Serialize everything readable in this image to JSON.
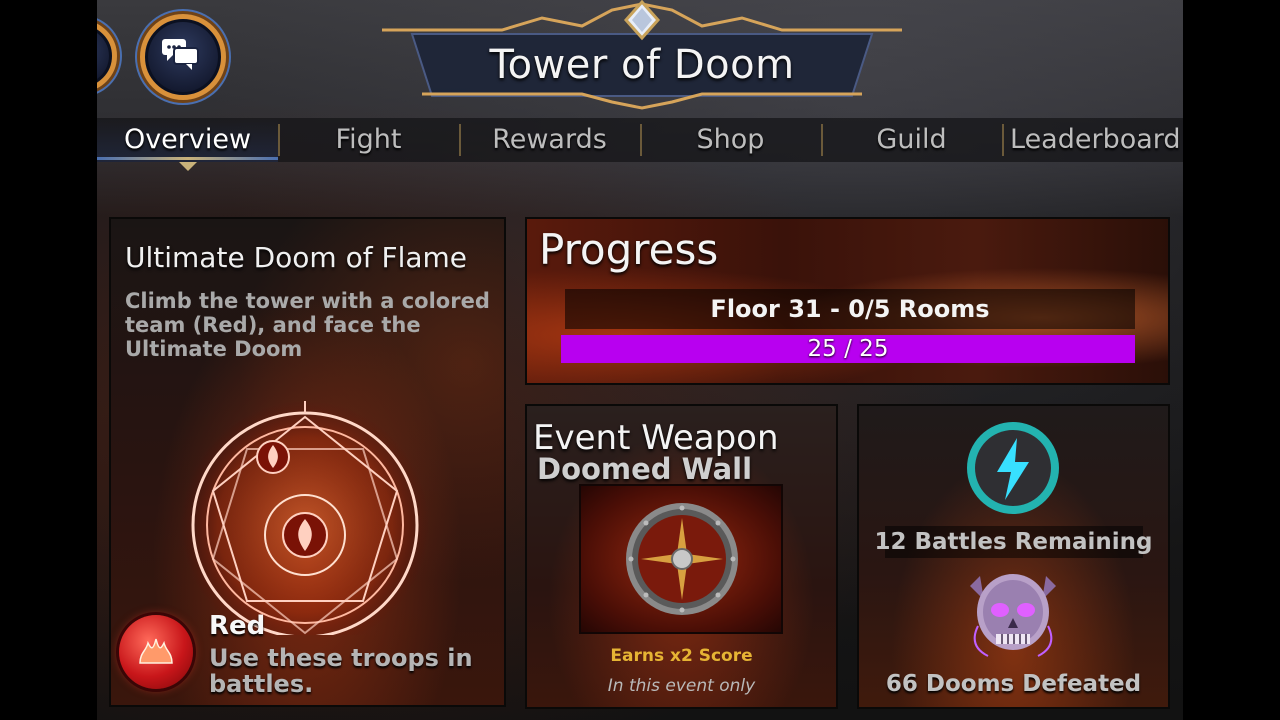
{
  "header": {
    "title": "Tower of Doom",
    "icons": [
      "partial-round-icon",
      "chat-icon"
    ]
  },
  "tabs": [
    {
      "label": "Overview",
      "active": true
    },
    {
      "label": "Fight",
      "active": false
    },
    {
      "label": "Rewards",
      "active": false
    },
    {
      "label": "Shop",
      "active": false
    },
    {
      "label": "Guild",
      "active": false
    },
    {
      "label": "Leaderboard",
      "active": false
    }
  ],
  "overview": {
    "title": "Ultimate Doom of Flame",
    "description": "Climb the tower with a colored team (Red), and face the Ultimate Doom",
    "color_name": "Red",
    "color_hint": "Use these troops in battles.",
    "color_hex": "#d81a1a"
  },
  "progress": {
    "title": "Progress",
    "floor_label": "Floor 31 - 0/5 Rooms",
    "bar_label": "25 / 25",
    "bar_fraction": 1.0,
    "bar_color": "#b800f0"
  },
  "weapon": {
    "heading": "Event Weapon",
    "name": "Doomed Wall",
    "bonus": "Earns x2 Score",
    "note": "In this event only"
  },
  "stats": {
    "battles": "12 Battles Remaining",
    "dooms": "66 Dooms Defeated"
  },
  "colors": {
    "accent_gold": "#d9913a",
    "energy_teal": "#2ec4c4",
    "skull_purple": "#c060ff"
  }
}
